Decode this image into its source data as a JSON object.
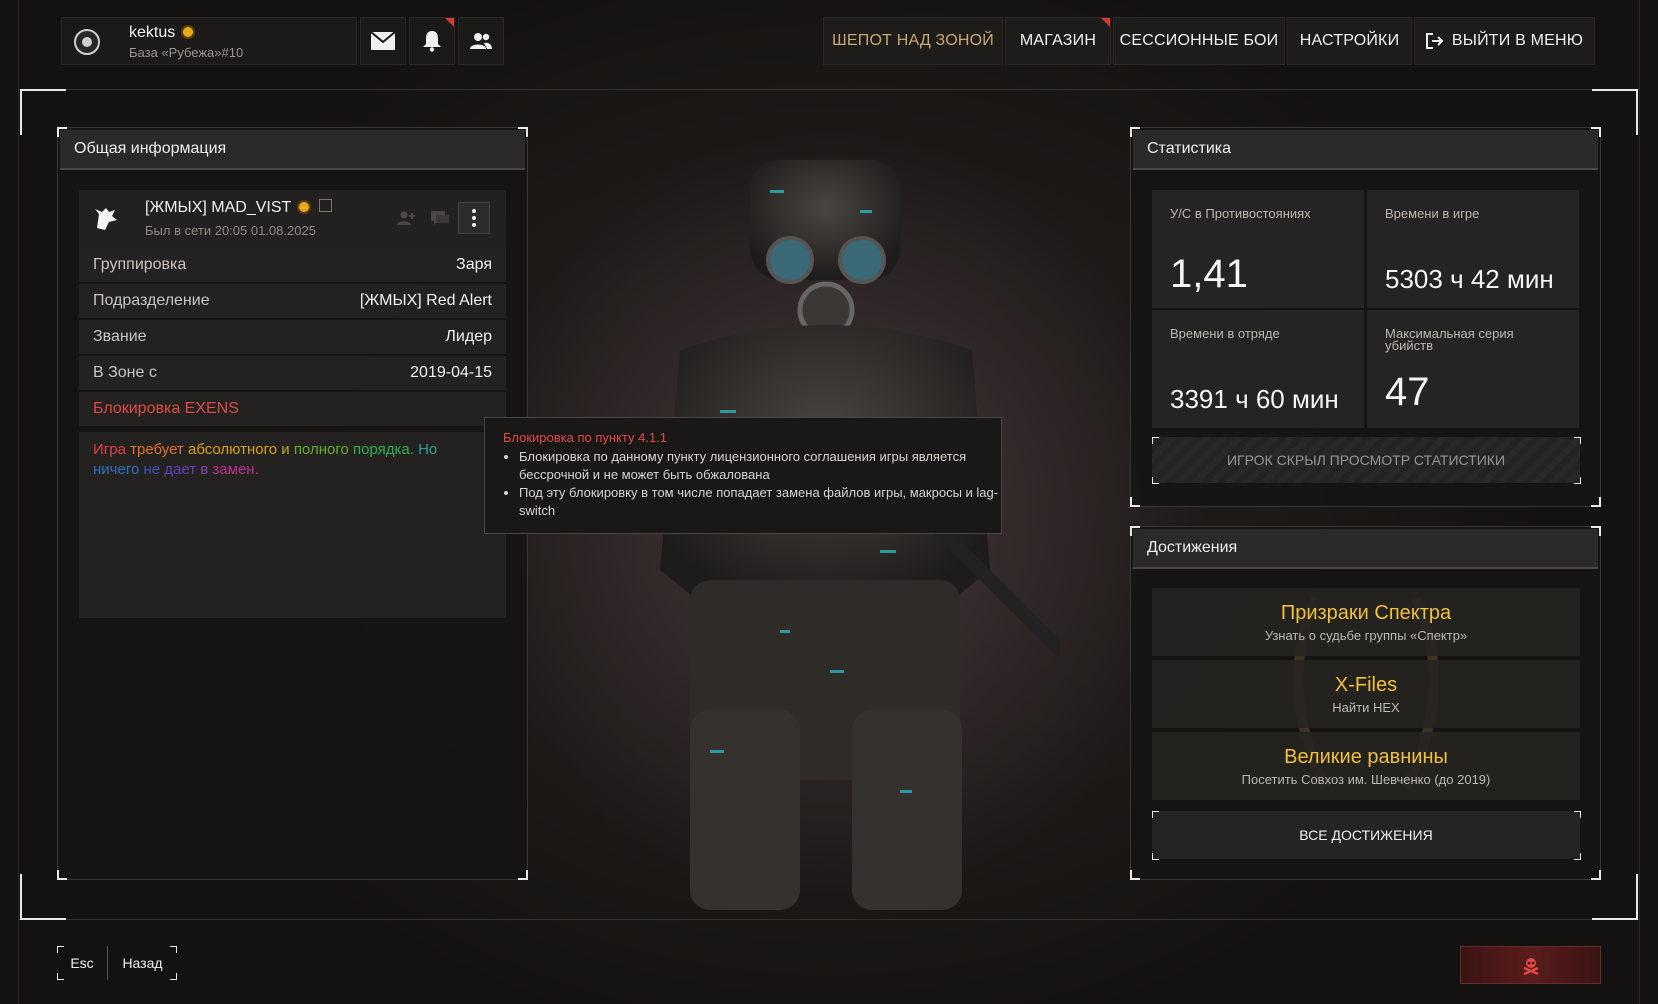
{
  "user": {
    "name": "kektus",
    "base": "База «Рубежа»#10"
  },
  "topbar": {
    "icons": [
      "mail-icon",
      "bell-icon",
      "friends-icon"
    ]
  },
  "nav": [
    "ШЕПОТ НАД ЗОНОЙ",
    "МАГАЗИН",
    "СЕССИОННЫЕ БОИ",
    "НАСТРОЙКИ",
    "ВЫЙТИ В МЕНЮ"
  ],
  "info": {
    "title": "Общая информация",
    "player_name": "[ЖМЫХ] MAD_VIST",
    "last_seen": "Был в сети 20:05 01.08.2025",
    "rows": [
      {
        "key": "Группировка",
        "value": "Заря"
      },
      {
        "key": "Подразделение",
        "value": "[ЖМЫХ] Red Alert"
      },
      {
        "key": "Звание",
        "value": "Лидер"
      },
      {
        "key": "В Зоне с",
        "value": "2019-04-15"
      }
    ],
    "ban_label": "Блокировка EXENS",
    "description_words": [
      "Игра",
      "требует",
      "абсолютного",
      "и",
      "полного",
      "порядка.",
      "Но",
      "ничего",
      "не",
      "дает",
      "в",
      "замен."
    ],
    "description_colors": [
      "#e04040",
      "#e07030",
      "#d8a020",
      "#b0b020",
      "#60b030",
      "#30b050",
      "#30a090",
      "#3070c0",
      "#4050c0",
      "#6040c0",
      "#9040b0",
      "#c03090"
    ]
  },
  "tooltip": {
    "title": "Блокировка по пункту 4.1.1",
    "items": [
      "Блокировка по данному пункту лицензионного соглашения игры является бессрочной и не может быть обжалована",
      "Под эту блокировку в том числе попадает замена файлов игры, макросы и lag-switch"
    ]
  },
  "stats": {
    "title": "Статистика",
    "cells": [
      {
        "label": "У/С в Противостояниях",
        "value": "1,41"
      },
      {
        "label": "Времени в игре",
        "value": "5303 ч 42 мин"
      },
      {
        "label": "Времени в отряде",
        "value": "3391 ч 60 мин"
      },
      {
        "label": "Максимальная серия убийств",
        "value": "47"
      }
    ],
    "hidden_notice": "ИГРОК СКРЫЛ ПРОСМОТР СТАТИСТИКИ"
  },
  "achievements": {
    "title": "Достижения",
    "items": [
      {
        "title": "Призраки Спектра",
        "desc": "Узнать о судьбе группы «Спектр»"
      },
      {
        "title": "X-Files",
        "desc": "Найти HEX"
      },
      {
        "title": "Великие равнины",
        "desc": "Посетить Совхоз им. Шевченко (до 2019)"
      }
    ],
    "all_button": "ВСЕ ДОСТИЖЕНИЯ"
  },
  "bottom": {
    "esc_key": "Esc",
    "esc_label": "Назад"
  },
  "colors": {
    "accent_gold": "#c8a872",
    "achievement_gold": "#f0c040",
    "ban_red": "#e04848"
  }
}
